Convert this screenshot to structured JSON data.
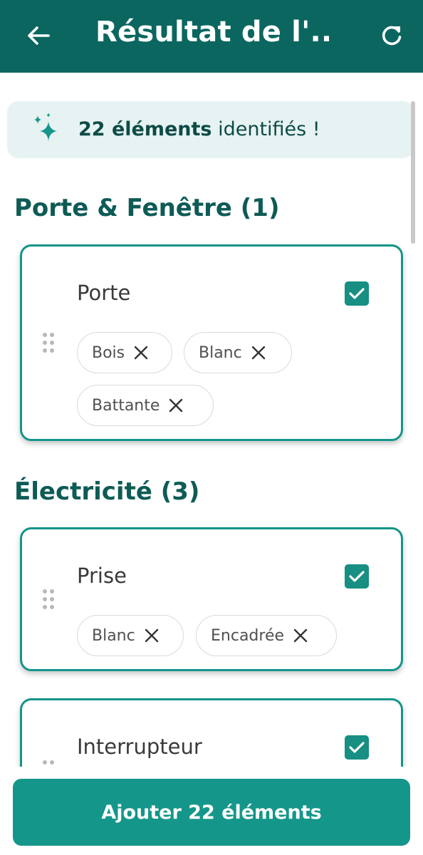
{
  "header": {
    "title": "Résultat de l'...",
    "back_icon": "arrow-left-icon",
    "refresh_icon": "refresh-icon",
    "background": "#0b6660"
  },
  "banner": {
    "count_text": "22 éléments",
    "suffix_text": " identifiés !",
    "icon": "sparkle-icon"
  },
  "sections": [
    {
      "title": "Porte & Fenêtre (1)",
      "items": [
        {
          "name": "Porte",
          "checked": true,
          "tags": [
            "Bois",
            "Blanc",
            "Battante"
          ]
        }
      ]
    },
    {
      "title": "Électricité (3)",
      "items": [
        {
          "name": "Prise",
          "checked": true,
          "tags": [
            "Blanc",
            "Encadrée"
          ]
        },
        {
          "name": "Interrupteur",
          "checked": true,
          "tags": []
        }
      ]
    }
  ],
  "footer": {
    "add_button_label": "Ajouter 22 éléments"
  },
  "colors": {
    "accent": "#15968a",
    "dark_teal": "#0b6660",
    "banner_bg": "#e7f3f2"
  }
}
